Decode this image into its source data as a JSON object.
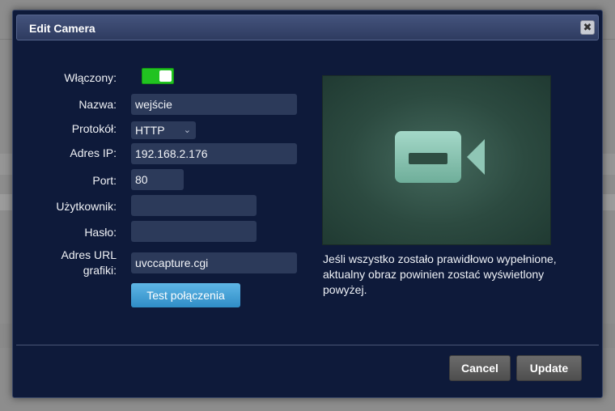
{
  "dialog": {
    "title": "Edit Camera",
    "close_symbol": "✖"
  },
  "form": {
    "enabled_label": "Włączony:",
    "enabled": true,
    "name_label": "Nazwa:",
    "name_value": "wejście",
    "protocol_label": "Protokół:",
    "protocol_value": "HTTP",
    "ip_label": "Adres IP:",
    "ip_value": "192.168.2.176",
    "port_label": "Port:",
    "port_value": "80",
    "user_label": "Użytkownik:",
    "user_value": "",
    "password_label": "Hasło:",
    "password_value": "",
    "url_label": "Adres URL grafiki:",
    "url_value": "uvccapture.cgi",
    "test_button": "Test połączenia"
  },
  "preview": {
    "icon": "video-camera-icon",
    "help_text": "Jeśli wszystko zostało prawidłowo wypełnione, aktualny obraz powinien zostać wyświetlony powyżej."
  },
  "footer": {
    "cancel_label": "Cancel",
    "update_label": "Update"
  },
  "colors": {
    "dialog_bg": "#0e1a3a",
    "toggle_on": "#21c321",
    "test_button": "#3a9ad6",
    "footer_button": "#5a5a5a"
  }
}
